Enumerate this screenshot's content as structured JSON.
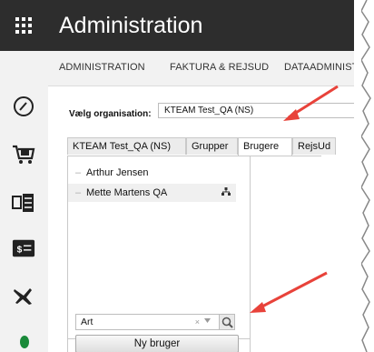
{
  "header": {
    "title": "Administration"
  },
  "sidebar": {
    "icons": [
      "apps-grid-icon",
      "gauge-icon",
      "shopping-cart-icon",
      "list-card-icon",
      "money-list-icon",
      "travel-plane-icon",
      "status-dot-icon"
    ]
  },
  "menubar": {
    "items": [
      "ADMINISTRATION",
      "FAKTURA & REJSUD",
      "DATAADMINISTR"
    ]
  },
  "organisation": {
    "label": "Vælg organisation:",
    "value": "KTEAM Test_QA (NS)"
  },
  "tabs": [
    {
      "label": "KTEAM Test_QA (NS)",
      "active": false
    },
    {
      "label": "Grupper",
      "active": false
    },
    {
      "label": "Brugere",
      "active": true
    },
    {
      "label": "RejsUd",
      "active": false
    }
  ],
  "users": [
    {
      "name": "Arthur Jensen",
      "selected": false
    },
    {
      "name": "Mette Martens QA",
      "selected": true
    }
  ],
  "search": {
    "value": "Art"
  },
  "actions": {
    "new_user_label": "Ny bruger"
  },
  "colors": {
    "header_bg": "#2d2d2d",
    "annotation_arrow": "#e8423a",
    "status_dot": "#1a8a3a"
  }
}
